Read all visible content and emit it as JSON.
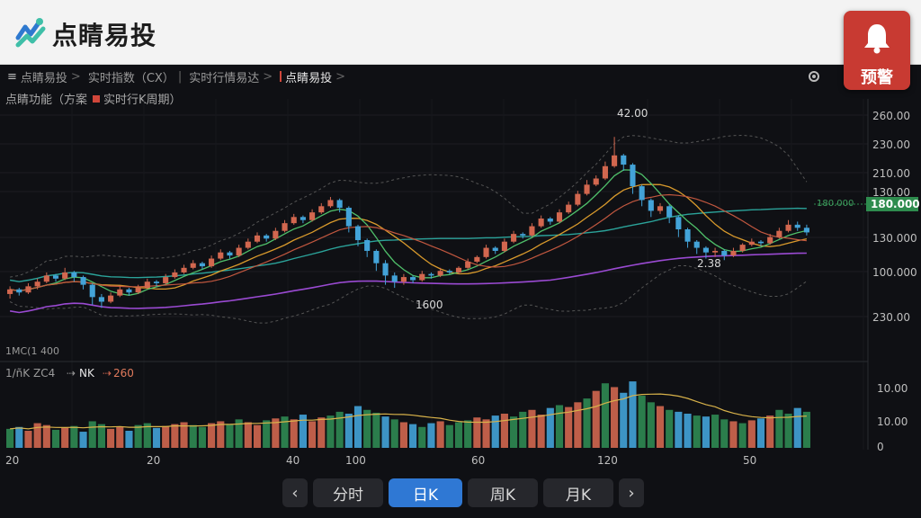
{
  "app": {
    "title": "点睛易投"
  },
  "alert": {
    "label": "预警"
  },
  "breadcrumb": [
    {
      "label": "点睛易投",
      "sep": ">"
    },
    {
      "label": "实时指数（CX）",
      "sep": "|"
    },
    {
      "label": "实时行情易达",
      "sep": ">"
    },
    {
      "label": "点睛易投",
      "sep": ">",
      "active": true
    }
  ],
  "subhead": {
    "left": "点睛功能（方案",
    "right": "实时行K周期）"
  },
  "indicator": {
    "label": "1/ñK ZC4",
    "arrow": "⇢",
    "nk": "NK",
    "value": "260"
  },
  "volume_axis_labels": [
    "10.00",
    "10.00",
    "0"
  ],
  "price_axis_labels": [
    "260.00",
    "230.00",
    "210.00",
    "130.00",
    "130.000",
    "100.000",
    "230.00"
  ],
  "price_tag": "180.000",
  "dotted_price_label": "180.000",
  "annotations": {
    "peak": "42.00",
    "low_mid": "1600",
    "low_right": "2.38",
    "lower_left": "1MC(1  400"
  },
  "x_axis_labels": [
    "20",
    "20",
    "40",
    "100",
    "60",
    "120",
    "50"
  ],
  "tabs": [
    {
      "label": "分时",
      "active": false
    },
    {
      "label": "日K",
      "active": true
    },
    {
      "label": "周K",
      "active": false
    },
    {
      "label": "月K",
      "active": false
    }
  ],
  "nav": {
    "prev": "‹",
    "next": "›"
  },
  "colors": {
    "up": "#d2674f",
    "down": "#43a3d8",
    "green_vol": "#2f8a52",
    "ma_teal": "#2ba39a",
    "ma_orange": "#d99a2c",
    "ma_green": "#4fbf6a",
    "ma_purple": "#9a4ad2",
    "ma_red": "#c1573f",
    "accent": "#2f78d4",
    "alert": "#c83a32"
  },
  "chart_data": {
    "type": "candlestick",
    "title": "",
    "candles": [
      {
        "o": 138,
        "c": 141,
        "h": 143,
        "l": 135
      },
      {
        "o": 141,
        "c": 139,
        "h": 142,
        "l": 137
      },
      {
        "o": 139,
        "c": 143,
        "h": 145,
        "l": 138
      },
      {
        "o": 143,
        "c": 146,
        "h": 148,
        "l": 141
      },
      {
        "o": 146,
        "c": 150,
        "h": 152,
        "l": 145
      },
      {
        "o": 150,
        "c": 148,
        "h": 151,
        "l": 146
      },
      {
        "o": 148,
        "c": 152,
        "h": 155,
        "l": 147
      },
      {
        "o": 152,
        "c": 149,
        "h": 153,
        "l": 146
      },
      {
        "o": 149,
        "c": 144,
        "h": 150,
        "l": 141
      },
      {
        "o": 144,
        "c": 136,
        "h": 145,
        "l": 131
      },
      {
        "o": 136,
        "c": 133,
        "h": 138,
        "l": 129
      },
      {
        "o": 133,
        "c": 137,
        "h": 139,
        "l": 132
      },
      {
        "o": 137,
        "c": 141,
        "h": 143,
        "l": 136
      },
      {
        "o": 141,
        "c": 139,
        "h": 142,
        "l": 137
      },
      {
        "o": 139,
        "c": 142,
        "h": 144,
        "l": 138
      },
      {
        "o": 142,
        "c": 146,
        "h": 148,
        "l": 141
      },
      {
        "o": 146,
        "c": 145,
        "h": 147,
        "l": 143
      },
      {
        "o": 145,
        "c": 149,
        "h": 151,
        "l": 144
      },
      {
        "o": 149,
        "c": 152,
        "h": 154,
        "l": 148
      },
      {
        "o": 152,
        "c": 155,
        "h": 157,
        "l": 151
      },
      {
        "o": 155,
        "c": 158,
        "h": 160,
        "l": 154
      },
      {
        "o": 158,
        "c": 156,
        "h": 159,
        "l": 154
      },
      {
        "o": 156,
        "c": 161,
        "h": 163,
        "l": 155
      },
      {
        "o": 161,
        "c": 165,
        "h": 167,
        "l": 160
      },
      {
        "o": 165,
        "c": 163,
        "h": 166,
        "l": 161
      },
      {
        "o": 163,
        "c": 168,
        "h": 170,
        "l": 162
      },
      {
        "o": 168,
        "c": 172,
        "h": 174,
        "l": 167
      },
      {
        "o": 172,
        "c": 176,
        "h": 178,
        "l": 171
      },
      {
        "o": 176,
        "c": 174,
        "h": 177,
        "l": 172
      },
      {
        "o": 174,
        "c": 179,
        "h": 181,
        "l": 173
      },
      {
        "o": 179,
        "c": 184,
        "h": 186,
        "l": 178
      },
      {
        "o": 184,
        "c": 188,
        "h": 190,
        "l": 183
      },
      {
        "o": 188,
        "c": 186,
        "h": 189,
        "l": 184
      },
      {
        "o": 186,
        "c": 191,
        "h": 193,
        "l": 185
      },
      {
        "o": 191,
        "c": 195,
        "h": 197,
        "l": 190
      },
      {
        "o": 195,
        "c": 199,
        "h": 201,
        "l": 194
      },
      {
        "o": 199,
        "c": 194,
        "h": 200,
        "l": 191
      },
      {
        "o": 194,
        "c": 182,
        "h": 195,
        "l": 178
      },
      {
        "o": 182,
        "c": 173,
        "h": 183,
        "l": 169
      },
      {
        "o": 173,
        "c": 166,
        "h": 174,
        "l": 162
      },
      {
        "o": 166,
        "c": 158,
        "h": 167,
        "l": 153
      },
      {
        "o": 158,
        "c": 150,
        "h": 160,
        "l": 144
      },
      {
        "o": 150,
        "c": 146,
        "h": 152,
        "l": 142
      },
      {
        "o": 146,
        "c": 149,
        "h": 151,
        "l": 144
      },
      {
        "o": 149,
        "c": 147,
        "h": 150,
        "l": 145
      },
      {
        "o": 147,
        "c": 151,
        "h": 153,
        "l": 146
      },
      {
        "o": 151,
        "c": 150,
        "h": 152,
        "l": 148
      },
      {
        "o": 150,
        "c": 153,
        "h": 155,
        "l": 149
      },
      {
        "o": 153,
        "c": 152,
        "h": 154,
        "l": 151
      },
      {
        "o": 152,
        "c": 155,
        "h": 156,
        "l": 151
      },
      {
        "o": 155,
        "c": 159,
        "h": 161,
        "l": 154
      },
      {
        "o": 159,
        "c": 162,
        "h": 163,
        "l": 158
      },
      {
        "o": 162,
        "c": 168,
        "h": 170,
        "l": 161
      },
      {
        "o": 168,
        "c": 166,
        "h": 169,
        "l": 164
      },
      {
        "o": 166,
        "c": 172,
        "h": 174,
        "l": 165
      },
      {
        "o": 172,
        "c": 177,
        "h": 179,
        "l": 171
      },
      {
        "o": 177,
        "c": 176,
        "h": 178,
        "l": 174
      },
      {
        "o": 176,
        "c": 182,
        "h": 184,
        "l": 175
      },
      {
        "o": 182,
        "c": 187,
        "h": 189,
        "l": 181
      },
      {
        "o": 187,
        "c": 185,
        "h": 188,
        "l": 183
      },
      {
        "o": 185,
        "c": 191,
        "h": 193,
        "l": 184
      },
      {
        "o": 191,
        "c": 196,
        "h": 198,
        "l": 190
      },
      {
        "o": 196,
        "c": 203,
        "h": 205,
        "l": 195
      },
      {
        "o": 203,
        "c": 209,
        "h": 212,
        "l": 202
      },
      {
        "o": 209,
        "c": 213,
        "h": 215,
        "l": 208
      },
      {
        "o": 213,
        "c": 221,
        "h": 224,
        "l": 212
      },
      {
        "o": 221,
        "c": 228,
        "h": 240,
        "l": 220
      },
      {
        "o": 228,
        "c": 222,
        "h": 229,
        "l": 218
      },
      {
        "o": 222,
        "c": 208,
        "h": 223,
        "l": 203
      },
      {
        "o": 208,
        "c": 199,
        "h": 209,
        "l": 195
      },
      {
        "o": 199,
        "c": 192,
        "h": 200,
        "l": 188
      },
      {
        "o": 192,
        "c": 195,
        "h": 197,
        "l": 190
      },
      {
        "o": 195,
        "c": 188,
        "h": 196,
        "l": 184
      },
      {
        "o": 188,
        "c": 180,
        "h": 189,
        "l": 175
      },
      {
        "o": 180,
        "c": 172,
        "h": 181,
        "l": 168
      },
      {
        "o": 172,
        "c": 168,
        "h": 173,
        "l": 164
      },
      {
        "o": 168,
        "c": 165,
        "h": 169,
        "l": 161
      },
      {
        "o": 165,
        "c": 166,
        "h": 168,
        "l": 162
      },
      {
        "o": 166,
        "c": 163,
        "h": 167,
        "l": 160
      },
      {
        "o": 163,
        "c": 166,
        "h": 168,
        "l": 162
      },
      {
        "o": 166,
        "c": 170,
        "h": 171,
        "l": 165
      },
      {
        "o": 170,
        "c": 172,
        "h": 174,
        "l": 169
      },
      {
        "o": 172,
        "c": 171,
        "h": 173,
        "l": 169
      },
      {
        "o": 171,
        "c": 175,
        "h": 177,
        "l": 170
      },
      {
        "o": 175,
        "c": 179,
        "h": 181,
        "l": 174
      },
      {
        "o": 179,
        "c": 183,
        "h": 186,
        "l": 178
      },
      {
        "o": 183,
        "c": 181,
        "h": 185,
        "l": 179
      },
      {
        "o": 181,
        "c": 178,
        "h": 183,
        "l": 176
      }
    ],
    "volume": [
      20,
      22,
      18,
      26,
      24,
      19,
      21,
      23,
      17,
      28,
      25,
      20,
      22,
      18,
      24,
      26,
      21,
      23,
      25,
      27,
      24,
      22,
      26,
      28,
      25,
      30,
      27,
      24,
      29,
      31,
      33,
      30,
      35,
      28,
      32,
      34,
      38,
      36,
      44,
      40,
      37,
      33,
      30,
      27,
      25,
      22,
      26,
      28,
      24,
      27,
      29,
      32,
      30,
      34,
      36,
      33,
      38,
      40,
      35,
      42,
      45,
      43,
      48,
      52,
      60,
      68,
      64,
      58,
      70,
      55,
      48,
      44,
      40,
      38,
      36,
      34,
      33,
      35,
      30,
      28,
      26,
      29,
      31,
      34,
      40,
      36,
      42,
      38
    ],
    "y_range": [
      100,
      260
    ]
  }
}
